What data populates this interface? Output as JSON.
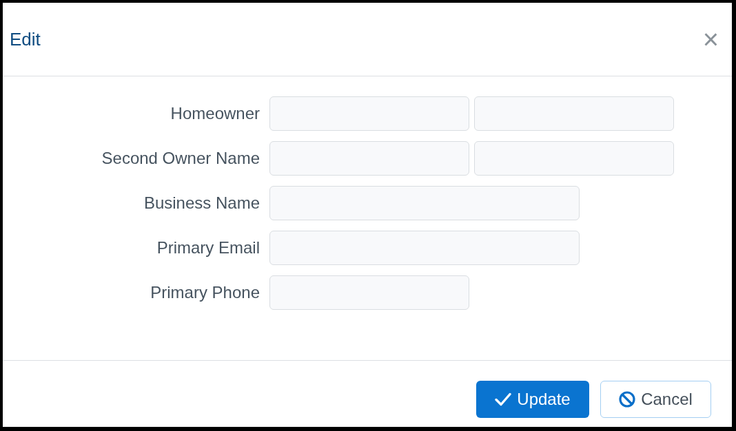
{
  "dialog": {
    "title": "Edit",
    "close": "×"
  },
  "fields": [
    {
      "label": "Homeowner",
      "kind": "pair"
    },
    {
      "label": "Second Owner Name",
      "kind": "pair"
    },
    {
      "label": "Business Name",
      "kind": "wide"
    },
    {
      "label": "Primary Email",
      "kind": "wide"
    },
    {
      "label": "Primary Phone",
      "kind": "short"
    }
  ],
  "buttons": [
    {
      "label": "Update",
      "kind": "primary"
    },
    {
      "label": "Cancel",
      "kind": "secondary"
    }
  ]
}
